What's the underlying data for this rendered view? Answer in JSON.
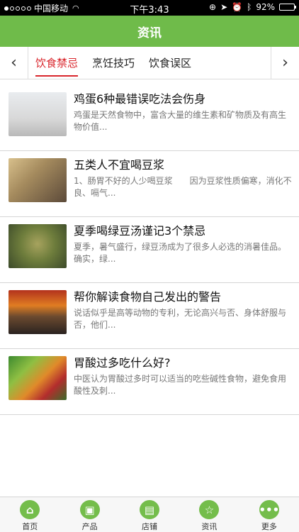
{
  "status_bar": {
    "carrier": "中国移动",
    "time": "下午3:43",
    "battery": "92%",
    "battery_level": 0.92
  },
  "header": {
    "title": "资讯"
  },
  "tabs": [
    {
      "label": "饮食禁忌",
      "active": true
    },
    {
      "label": "烹饪技巧",
      "active": false
    },
    {
      "label": "饮食误区",
      "active": false
    }
  ],
  "articles": [
    {
      "title": "鸡蛋6种最错误吃法会伤身",
      "desc": "鸡蛋是天然食物中，富含大量的维生素和矿物质及有高生物价值...",
      "thumb": "egg-image"
    },
    {
      "title": "五类人不宜喝豆浆",
      "desc": "1、肠胃不好的人少喝豆浆　　因为豆浆性质偏寒，消化不良、嗝气...",
      "thumb": "soy-milk-image"
    },
    {
      "title": "夏季喝绿豆汤谨记3个禁忌",
      "desc": "夏季，暑气盛行，绿豆汤成为了很多人必选的消暑佳品。确实，绿...",
      "thumb": "mung-bean-soup-image"
    },
    {
      "title": "帮你解读食物自己发出的警告",
      "desc": "说话似乎是高等动物的专利，无论高兴与否、身体舒服与否，他们...",
      "thumb": "grilled-food-image"
    },
    {
      "title": "胃酸过多吃什么好?",
      "desc": "中医认为胃酸过多时可以适当的吃些碱性食物，避免食用酸性及刺...",
      "thumb": "vegetables-image"
    }
  ],
  "bottom_nav": [
    {
      "label": "首页",
      "icon": "home-icon",
      "glyph": "⌂"
    },
    {
      "label": "产品",
      "icon": "product-box-icon",
      "glyph": "▣"
    },
    {
      "label": "店铺",
      "icon": "store-icon",
      "glyph": "▤"
    },
    {
      "label": "资讯",
      "icon": "news-star-icon",
      "glyph": "☆"
    },
    {
      "label": "更多",
      "icon": "more-dots-icon",
      "glyph": "•••"
    }
  ],
  "colors": {
    "accent": "#6fbb4a",
    "active_tab": "#d9262c"
  }
}
